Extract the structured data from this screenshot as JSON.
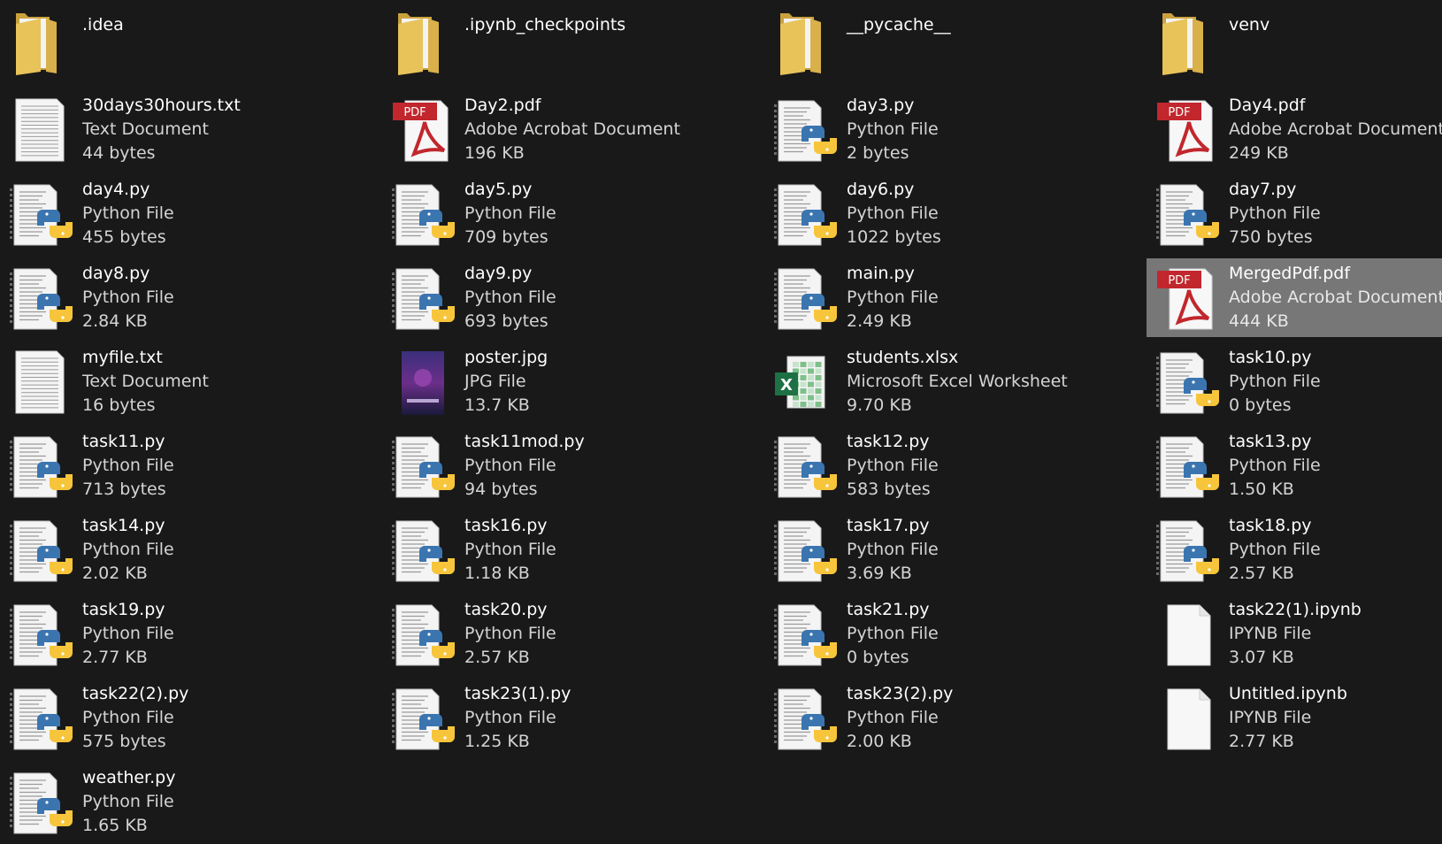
{
  "files": [
    {
      "name": ".idea",
      "type": "",
      "size": "",
      "icon": "folder-icon"
    },
    {
      "name": ".ipynb_checkpoints",
      "type": "",
      "size": "",
      "icon": "folder-icon"
    },
    {
      "name": "__pycache__",
      "type": "",
      "size": "",
      "icon": "folder-icon"
    },
    {
      "name": "venv",
      "type": "",
      "size": "",
      "icon": "folder-icon"
    },
    {
      "name": "30days30hours.txt",
      "type": "Text Document",
      "size": "44 bytes",
      "icon": "text-file-icon"
    },
    {
      "name": "Day2.pdf",
      "type": "Adobe Acrobat Document",
      "size": "196 KB",
      "icon": "pdf-icon"
    },
    {
      "name": "day3.py",
      "type": "Python File",
      "size": "2 bytes",
      "icon": "python-file-icon"
    },
    {
      "name": "Day4.pdf",
      "type": "Adobe Acrobat Document",
      "size": "249 KB",
      "icon": "pdf-icon"
    },
    {
      "name": "day4.py",
      "type": "Python File",
      "size": "455 bytes",
      "icon": "python-file-icon"
    },
    {
      "name": "day5.py",
      "type": "Python File",
      "size": "709 bytes",
      "icon": "python-file-icon"
    },
    {
      "name": "day6.py",
      "type": "Python File",
      "size": "1022 bytes",
      "icon": "python-file-icon"
    },
    {
      "name": "day7.py",
      "type": "Python File",
      "size": "750 bytes",
      "icon": "python-file-icon"
    },
    {
      "name": "day8.py",
      "type": "Python File",
      "size": "2.84 KB",
      "icon": "python-file-icon"
    },
    {
      "name": "day9.py",
      "type": "Python File",
      "size": "693 bytes",
      "icon": "python-file-icon"
    },
    {
      "name": "main.py",
      "type": "Python File",
      "size": "2.49 KB",
      "icon": "python-file-icon"
    },
    {
      "name": "MergedPdf.pdf",
      "type": "Adobe Acrobat Document",
      "size": "444 KB",
      "icon": "pdf-icon",
      "selected": true
    },
    {
      "name": "myfile.txt",
      "type": "Text Document",
      "size": "16 bytes",
      "icon": "text-file-icon"
    },
    {
      "name": "poster.jpg",
      "type": "JPG File",
      "size": "13.7 KB",
      "icon": "image-thumbnail-icon"
    },
    {
      "name": "students.xlsx",
      "type": "Microsoft Excel Worksheet",
      "size": "9.70 KB",
      "icon": "excel-icon"
    },
    {
      "name": "task10.py",
      "type": "Python File",
      "size": "0 bytes",
      "icon": "python-file-icon"
    },
    {
      "name": "task11.py",
      "type": "Python File",
      "size": "713 bytes",
      "icon": "python-file-icon"
    },
    {
      "name": "task11mod.py",
      "type": "Python File",
      "size": "94 bytes",
      "icon": "python-file-icon"
    },
    {
      "name": "task12.py",
      "type": "Python File",
      "size": "583 bytes",
      "icon": "python-file-icon"
    },
    {
      "name": "task13.py",
      "type": "Python File",
      "size": "1.50 KB",
      "icon": "python-file-icon"
    },
    {
      "name": "task14.py",
      "type": "Python File",
      "size": "2.02 KB",
      "icon": "python-file-icon"
    },
    {
      "name": "task16.py",
      "type": "Python File",
      "size": "1.18 KB",
      "icon": "python-file-icon"
    },
    {
      "name": "task17.py",
      "type": "Python File",
      "size": "3.69 KB",
      "icon": "python-file-icon"
    },
    {
      "name": "task18.py",
      "type": "Python File",
      "size": "2.57 KB",
      "icon": "python-file-icon"
    },
    {
      "name": "task19.py",
      "type": "Python File",
      "size": "2.77 KB",
      "icon": "python-file-icon"
    },
    {
      "name": "task20.py",
      "type": "Python File",
      "size": "2.57 KB",
      "icon": "python-file-icon"
    },
    {
      "name": "task21.py",
      "type": "Python File",
      "size": "0 bytes",
      "icon": "python-file-icon"
    },
    {
      "name": "task22(1).ipynb",
      "type": "IPYNB File",
      "size": "3.07 KB",
      "icon": "blank-file-icon"
    },
    {
      "name": "task22(2).py",
      "type": "Python File",
      "size": "575 bytes",
      "icon": "python-file-icon"
    },
    {
      "name": "task23(1).py",
      "type": "Python File",
      "size": "1.25 KB",
      "icon": "python-file-icon"
    },
    {
      "name": "task23(2).py",
      "type": "Python File",
      "size": "2.00 KB",
      "icon": "python-file-icon"
    },
    {
      "name": "Untitled.ipynb",
      "type": "IPYNB File",
      "size": "2.77 KB",
      "icon": "blank-file-icon"
    },
    {
      "name": "weather.py",
      "type": "Python File",
      "size": "1.65 KB",
      "icon": "python-file-icon"
    }
  ],
  "colors": {
    "background": "#191919",
    "selection": "#777777",
    "folder": "#e8c35a",
    "pdf_red": "#c1272d",
    "excel_green": "#1e7145",
    "python_blue": "#3b75b0",
    "python_yellow": "#f7c53b"
  }
}
